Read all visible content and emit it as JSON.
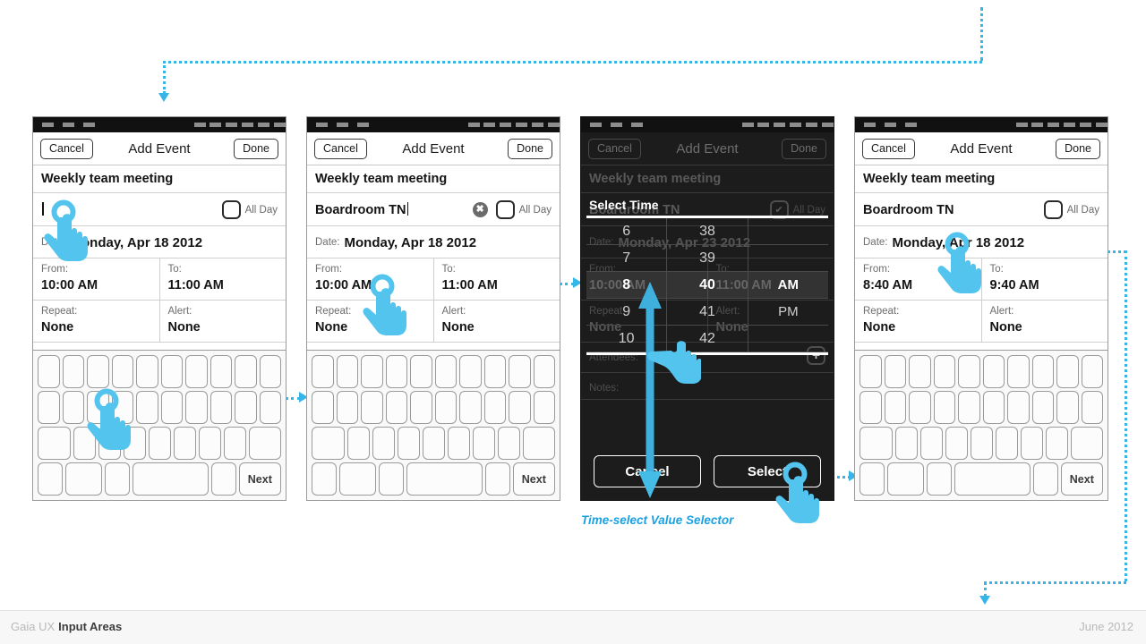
{
  "page": {
    "background": "#ffffff",
    "accent": "#35b5e8",
    "caption": "Time-select Value Selector"
  },
  "footer": {
    "brand": "Gaia UX",
    "section": "Input Areas",
    "date": "June 2012"
  },
  "nav": {
    "cancel": "Cancel",
    "title": "Add Event",
    "done": "Done"
  },
  "labels": {
    "date": "Date:",
    "from": "From:",
    "to": "To:",
    "repeat": "Repeat:",
    "alert": "Alert:",
    "attendees": "Attendees:",
    "notes": "Notes:",
    "all_day": "All Day",
    "next_key": "Next",
    "clear_icon": "✖",
    "plus_icon": "+",
    "check_icon": "✔"
  },
  "panels": [
    {
      "id": "panel-1",
      "theme": "light",
      "event_title": "Weekly team meeting",
      "location": "",
      "location_caret": true,
      "show_clear": false,
      "date": "Monday, Apr 18 2012",
      "from": "10:00 AM",
      "to": "11:00 AM",
      "repeat": "None",
      "alert": "None"
    },
    {
      "id": "panel-2",
      "theme": "light",
      "event_title": "Weekly team meeting",
      "location": "Boardroom TN",
      "location_caret": true,
      "show_clear": true,
      "date": "Monday, Apr 18 2012",
      "from": "10:00 AM",
      "to": "11:00 AM",
      "repeat": "None",
      "alert": "None"
    },
    {
      "id": "panel-3",
      "theme": "dark",
      "event_title": "Weekly team meeting",
      "location": "Boardroom TN",
      "location_caret": false,
      "show_clear": false,
      "date": "Monday, Apr 23 2012",
      "from": "10:00 AM",
      "to": "11:00 AM",
      "repeat": "None",
      "alert": "None"
    },
    {
      "id": "panel-4",
      "theme": "light",
      "event_title": "Weekly team meeting",
      "location": "Boardroom TN",
      "location_caret": false,
      "show_clear": false,
      "date": "Monday, Apr 18 2012",
      "from": "8:40 AM",
      "to": "9:40 AM",
      "repeat": "None",
      "alert": "None"
    }
  ],
  "time_selector": {
    "title": "Select Time",
    "hours": [
      "6",
      "7",
      "8",
      "9",
      "10"
    ],
    "hours_selected_index": 2,
    "minutes": [
      "38",
      "39",
      "40",
      "41",
      "42"
    ],
    "minutes_selected_index": 2,
    "meridiem": [
      "",
      "",
      "AM",
      "PM",
      ""
    ],
    "meridiem_selected_index": 2,
    "cancel": "Cancel",
    "select": "Select"
  },
  "keyboard": {
    "row1_count": 10,
    "row2_count": 10,
    "row3_count": 9,
    "next_label": "Next"
  }
}
